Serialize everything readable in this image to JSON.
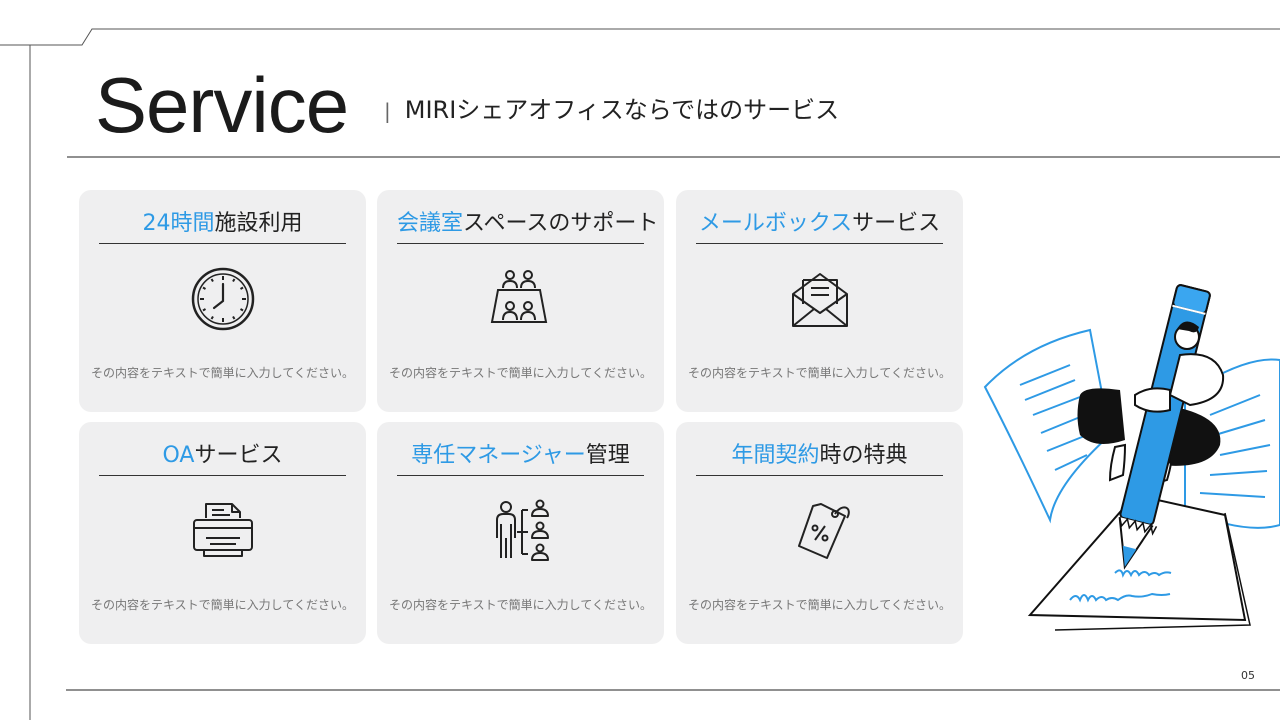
{
  "header": {
    "title": "Service",
    "separator": "|",
    "subtitle": "MIRIシェアオフィスならではのサービス"
  },
  "cards": [
    {
      "title_highlight": "24時間",
      "title_rest": "施設利用",
      "icon": "clock-icon",
      "description": "その内容をテキストで簡単に入力してください。"
    },
    {
      "title_highlight": "会議室",
      "title_rest": "スペースのサポート",
      "icon": "meeting-room-icon",
      "description": "その内容をテキストで簡単に入力してください。"
    },
    {
      "title_highlight": "メールボックス",
      "title_rest": "サービス",
      "icon": "mail-envelope-icon",
      "description": "その内容をテキストで簡単に入力してください。"
    },
    {
      "title_highlight": "OA",
      "title_rest": "サービス",
      "icon": "printer-icon",
      "description": "その内容をテキストで簡単に入力してください。"
    },
    {
      "title_highlight": "専任マネージャー",
      "title_rest": "管理",
      "icon": "manager-org-icon",
      "description": "その内容をテキストで簡単に入力してください。"
    },
    {
      "title_highlight": "年間契約",
      "title_rest": "時の特典",
      "icon": "discount-tag-icon",
      "description": "その内容をテキストで簡単に入力してください。"
    }
  ],
  "page_number": "05",
  "colors": {
    "accent": "#2e9ae5",
    "card_bg": "#efeff0",
    "text": "#222222"
  }
}
